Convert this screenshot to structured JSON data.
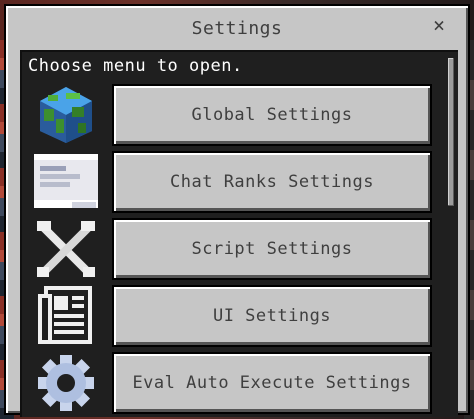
{
  "dialog": {
    "title": "Settings",
    "close_label": "×",
    "prompt": "Choose menu to open."
  },
  "menu": {
    "items": [
      {
        "label": "Global Settings",
        "icon": "globe-icon"
      },
      {
        "label": "Chat Ranks Settings",
        "icon": "chat-window-icon"
      },
      {
        "label": "Script Settings",
        "icon": "tools-icon"
      },
      {
        "label": "UI Settings",
        "icon": "document-icon"
      },
      {
        "label": "Eval Auto Execute Settings",
        "icon": "gear-icon"
      }
    ]
  },
  "colors": {
    "frame": "#c6c6c6",
    "panel": "#1f1f1f",
    "button_text": "#3f3f3f",
    "prompt_text": "#ffffff"
  }
}
